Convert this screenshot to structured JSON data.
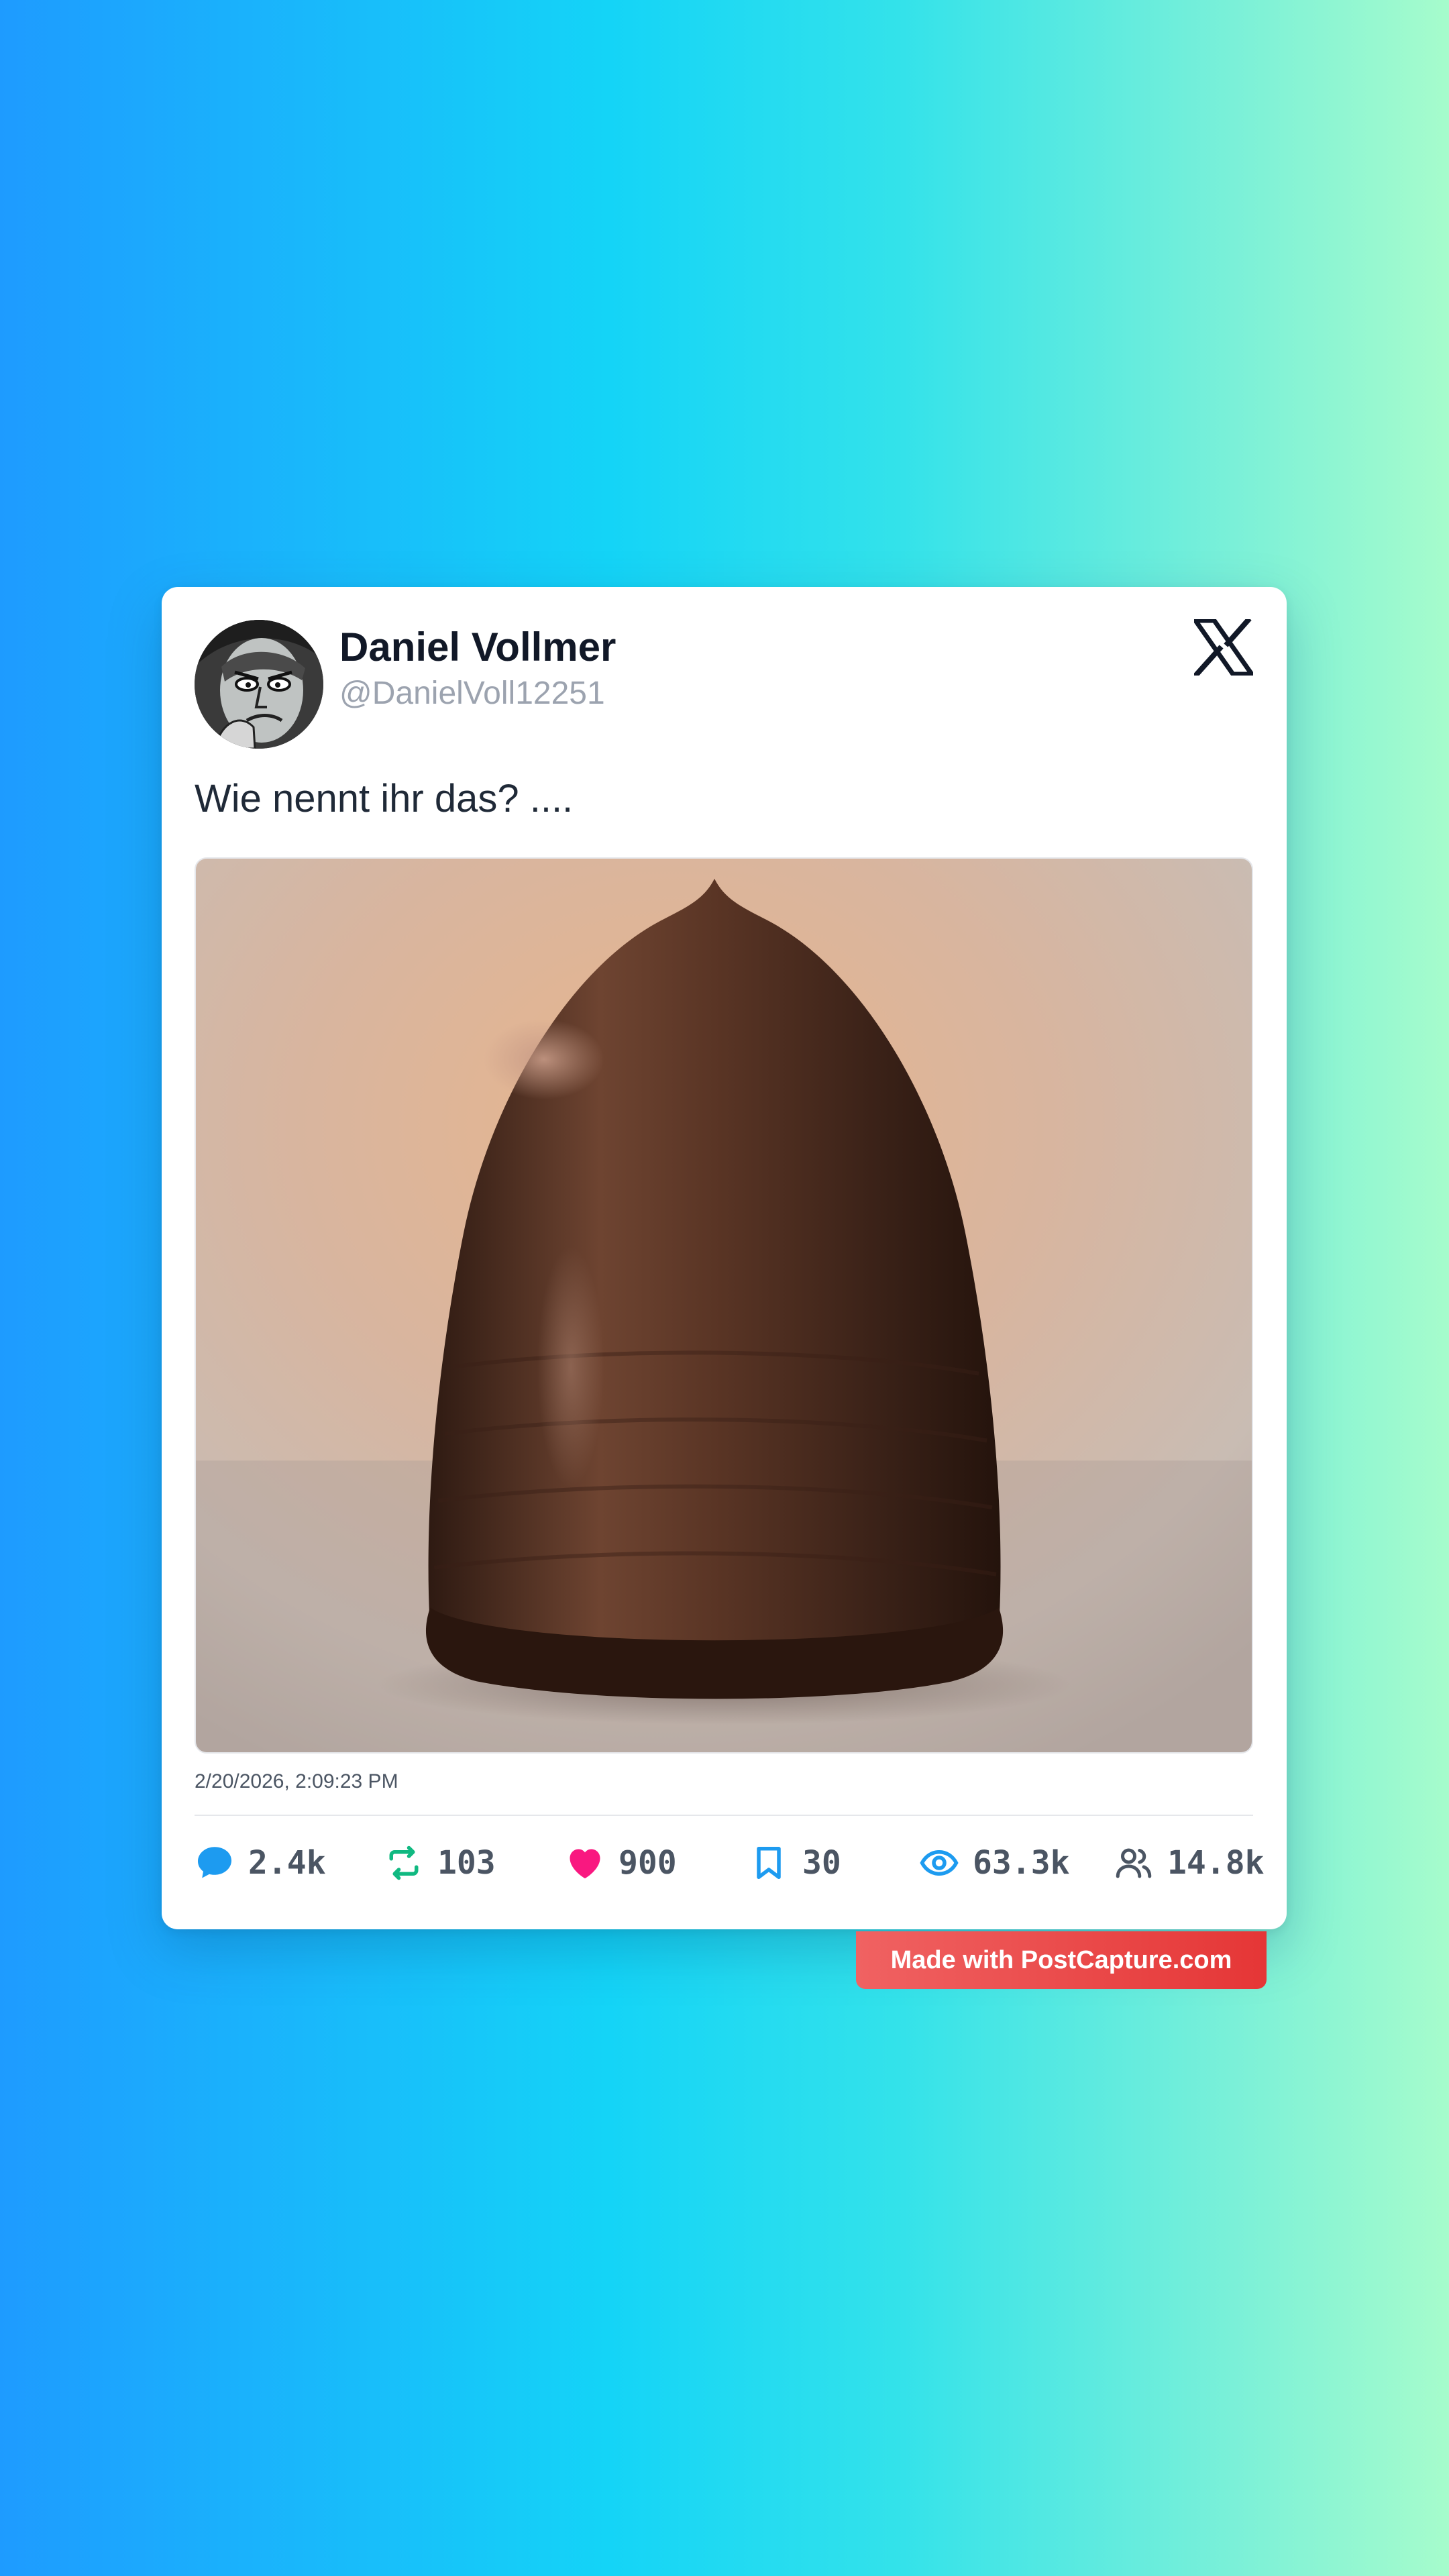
{
  "tweet": {
    "display_name": "Daniel Vollmer",
    "handle": "@DanielVoll12251",
    "text": "Wie nennt ihr das? ....",
    "timestamp": "2/20/2026, 2:09:23 PM",
    "media_icon": "chocolate-marshmallow-photo",
    "platform_icon": "x-logo-icon"
  },
  "stats": {
    "replies": "2.4k",
    "retweets": "103",
    "likes": "900",
    "bookmarks": "30",
    "views": "63.3k",
    "followers": "14.8k"
  },
  "watermark": {
    "text": "Made with PostCapture.com"
  },
  "colors": {
    "reply": "#1d9bf0",
    "retweet": "#10b981",
    "like": "#f91880",
    "bookmark": "#1d9bf0",
    "views": "#1d9bf0",
    "followers": "#4b5563",
    "watermark": "#e53e3e"
  }
}
